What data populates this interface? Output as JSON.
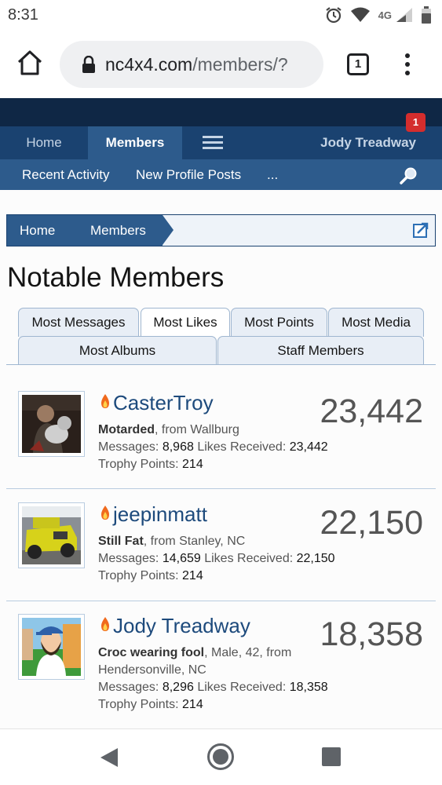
{
  "status_bar": {
    "time": "8:31",
    "network": "4G",
    "icons": [
      "alarm-icon",
      "wifi-icon",
      "signal-icon",
      "battery-icon"
    ]
  },
  "browser": {
    "url_host": "nc4x4.com",
    "url_path": "/members/?",
    "tab_count": "1",
    "icons": [
      "home-icon",
      "lock-icon",
      "more-vert-icon"
    ]
  },
  "site_nav": {
    "tabs": [
      {
        "label": "Home"
      },
      {
        "label": "Members"
      }
    ],
    "user": "Jody Treadway",
    "notification_count": "1",
    "accent": "#1a4270",
    "active_tab_color": "#2d5b8c"
  },
  "sub_nav": {
    "items": [
      {
        "label": "Recent Activity"
      },
      {
        "label": "New Profile Posts"
      },
      {
        "label": "..."
      }
    ]
  },
  "breadcrumb": [
    {
      "label": "Home"
    },
    {
      "label": "Members"
    }
  ],
  "page_title": "Notable Members",
  "member_tabs": [
    {
      "label": "Most Messages",
      "active": false
    },
    {
      "label": "Most Likes",
      "active": true
    },
    {
      "label": "Most Points",
      "active": false
    },
    {
      "label": "Most Media",
      "active": false
    },
    {
      "label": "Most Albums",
      "active": false
    },
    {
      "label": "Staff Members",
      "active": false
    }
  ],
  "members": [
    {
      "name": "CasterTroy",
      "score": "23,442",
      "title": "Motarded",
      "meta_line1": ", from Wallburg",
      "meta_line2": "",
      "messages_label": "Messages:",
      "messages": "8,968",
      "likes_label": "Likes Received:",
      "likes": "23,442",
      "trophy_label": "Trophy Points:",
      "trophy": "214"
    },
    {
      "name": "jeepinmatt",
      "score": "22,150",
      "title": "Still Fat",
      "meta_line1": ", from Stanley, NC",
      "meta_line2": "",
      "messages_label": "Messages:",
      "messages": "14,659",
      "likes_label": "Likes Received:",
      "likes": "22,150",
      "trophy_label": "Trophy Points:",
      "trophy": "214"
    },
    {
      "name": "Jody Treadway",
      "score": "18,358",
      "title": "Croc wearing fool",
      "meta_line1": ", Male, 42, from",
      "meta_line2": "Hendersonville, NC",
      "messages_label": "Messages:",
      "messages": "8,296",
      "likes_label": "Likes Received:",
      "likes": "18,358",
      "trophy_label": "Trophy Points:",
      "trophy": "214"
    }
  ],
  "android_nav": [
    "back-icon",
    "home-circle-icon",
    "recents-icon"
  ]
}
